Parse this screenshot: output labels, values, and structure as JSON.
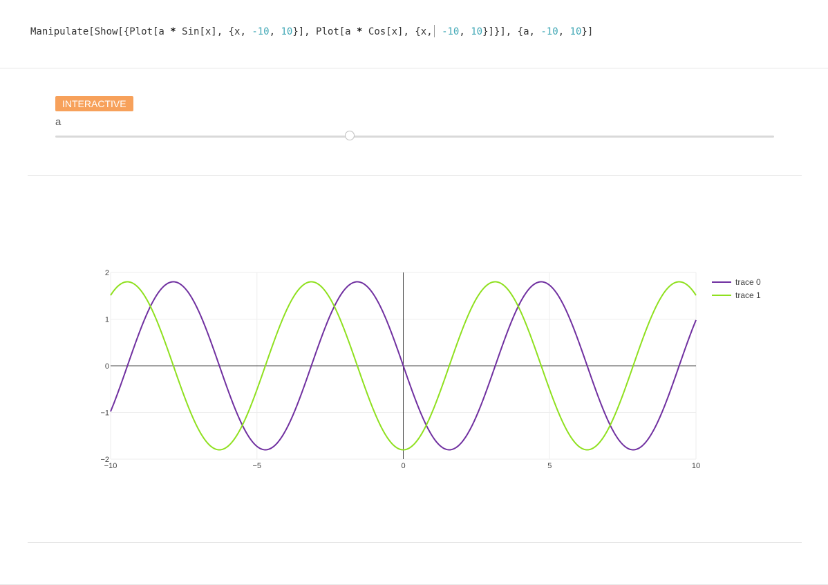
{
  "cell": {
    "code_parts": [
      {
        "t": "Manipulate[Show[{Plot[a ",
        "c": "plain"
      },
      {
        "t": "*",
        "c": "op"
      },
      {
        "t": " Sin[x], {x, ",
        "c": "plain"
      },
      {
        "t": "-10",
        "c": "num"
      },
      {
        "t": ", ",
        "c": "plain"
      },
      {
        "t": "10",
        "c": "num"
      },
      {
        "t": "}], Plot[a ",
        "c": "plain"
      },
      {
        "t": "*",
        "c": "op"
      },
      {
        "t": " Cos[x], {x,",
        "c": "plain"
      },
      {
        "t": "",
        "c": "caret"
      },
      {
        "t": " -10",
        "c": "num"
      },
      {
        "t": ", ",
        "c": "plain"
      },
      {
        "t": "10",
        "c": "num"
      },
      {
        "t": "}]}], {a, ",
        "c": "plain"
      },
      {
        "t": "-10",
        "c": "num"
      },
      {
        "t": ", ",
        "c": "plain"
      },
      {
        "t": "10",
        "c": "num"
      },
      {
        "t": "}]",
        "c": "plain"
      }
    ]
  },
  "controls": {
    "badge": "INTERACTIVE",
    "param_label": "a",
    "slider": {
      "min": -10,
      "max": 10,
      "value": -1.8
    }
  },
  "colors": {
    "trace0": "#7030a0",
    "trace1": "#8fe01f",
    "axis": "#444444",
    "grid": "#eeeeee"
  },
  "chart_data": {
    "type": "line",
    "xlim": [
      -10,
      10
    ],
    "ylim": [
      -2,
      2
    ],
    "x_ticks": [
      -10,
      -5,
      0,
      5,
      10
    ],
    "x_tick_labels": [
      "−10",
      "−5",
      "0",
      "5",
      "10"
    ],
    "y_ticks": [
      -2,
      -1,
      0,
      1,
      2
    ],
    "y_tick_labels": [
      "−2",
      "−1",
      "0",
      "1",
      "2"
    ],
    "grid": true,
    "legend": "top-right",
    "series": [
      {
        "name": "trace 0",
        "function": "a*sin(x)",
        "amplitude": -1.8
      },
      {
        "name": "trace 1",
        "function": "a*cos(x)",
        "amplitude": -1.8
      }
    ]
  }
}
